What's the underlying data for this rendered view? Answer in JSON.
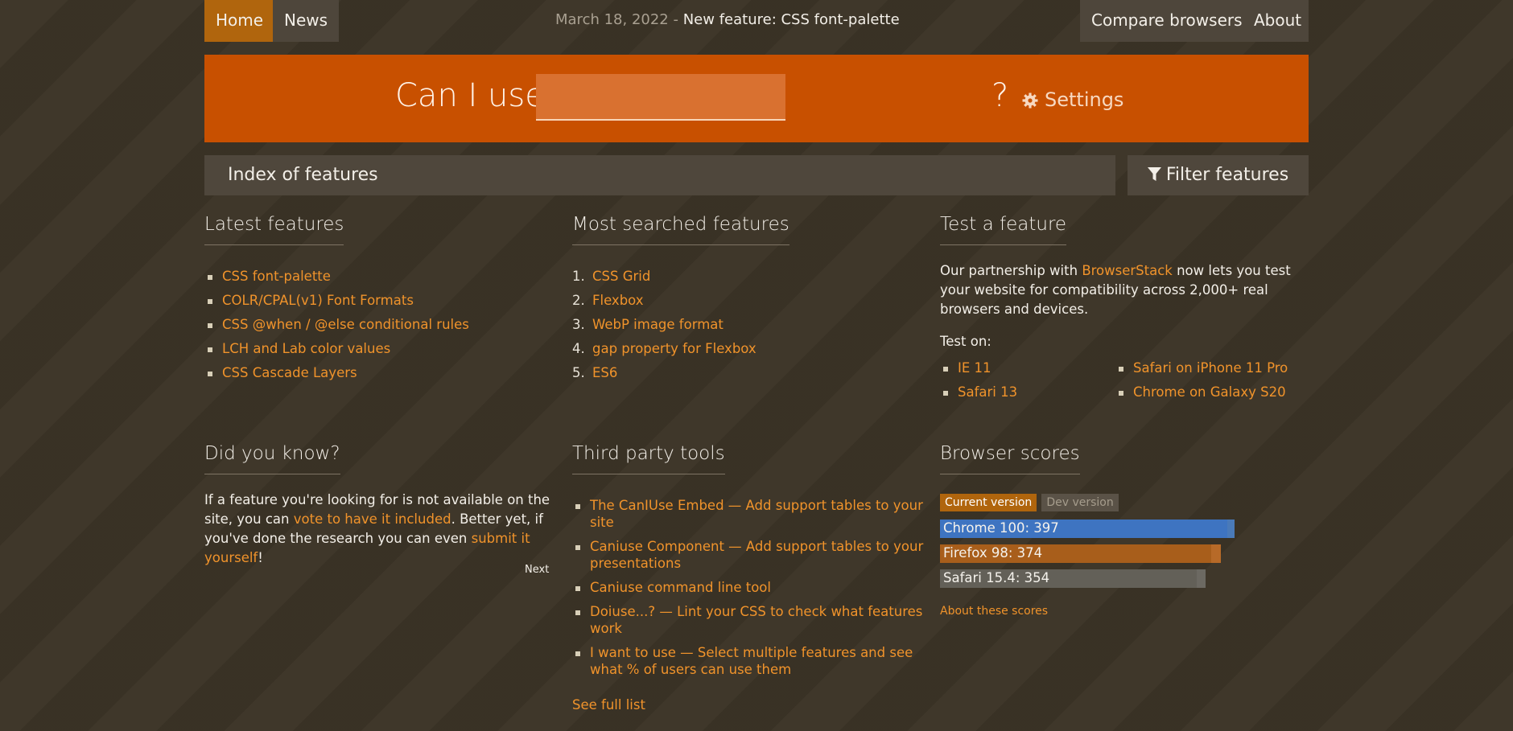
{
  "nav": {
    "home": "Home",
    "news": "News",
    "news_date": "March 18, 2022",
    "news_separator": "-",
    "news_link": "New feature: CSS font-palette",
    "compare": "Compare browsers",
    "about": "About"
  },
  "search": {
    "prefix": "Can I use",
    "value": "",
    "suffix": "?",
    "settings": "Settings"
  },
  "index": {
    "title": "Index of features",
    "filter": "Filter features"
  },
  "latest": {
    "title": "Latest features",
    "items": [
      "CSS font-palette",
      "COLR/CPAL(v1) Font Formats",
      "CSS @when / @else conditional rules",
      "LCH and Lab color values",
      "CSS Cascade Layers"
    ]
  },
  "most_searched": {
    "title": "Most searched features",
    "items": [
      {
        "n": "1.",
        "label": "CSS Grid"
      },
      {
        "n": "2.",
        "label": "Flexbox"
      },
      {
        "n": "3.",
        "label": "WebP image format"
      },
      {
        "n": "4.",
        "label": "gap property for Flexbox"
      },
      {
        "n": "5.",
        "label": "ES6"
      }
    ]
  },
  "test": {
    "title": "Test a feature",
    "text_before": "Our partnership with ",
    "link": "BrowserStack",
    "text_after": " now lets you test your website for compatibility across 2,000+ real browsers and devices.",
    "test_on": "Test on:",
    "browsers_left": [
      "IE 11",
      "Safari 13"
    ],
    "browsers_right": [
      "Safari on iPhone 11 Pro",
      "Chrome on Galaxy S20"
    ]
  },
  "did_you_know": {
    "title": "Did you know?",
    "t1": "If a feature you're looking for is not available on the site, you can ",
    "l1": "vote to have it included",
    "t2": ". Better yet, if you've done the research you can even ",
    "l2": "submit it yourself",
    "t3": "!",
    "next": "Next"
  },
  "tools": {
    "title": "Third party tools",
    "items": [
      "The CanIUse Embed — Add support tables to your site",
      "Caniuse Component — Add support tables to your presentations",
      "Caniuse command line tool",
      "Doiuse...? — Lint your CSS to check what features work",
      "I want to use — Select multiple features and see what % of users can use them"
    ],
    "see_full": "See full list"
  },
  "scores": {
    "title": "Browser scores",
    "tab_current": "Current version",
    "tab_dev": "Dev version",
    "bars": [
      {
        "label": "Chrome 100: 397",
        "score": 397,
        "dev": 407,
        "color": "#3e74c1",
        "bg": "#4a7ab8"
      },
      {
        "label": "Firefox 98: 374",
        "score": 374,
        "dev": 388,
        "color": "#a85e1b",
        "bg": "#b76a28"
      },
      {
        "label": "Safari 15.4: 354",
        "score": 354,
        "dev": 367,
        "color": "#636058",
        "bg": "#6c6962"
      }
    ],
    "about": "About these scores"
  }
}
